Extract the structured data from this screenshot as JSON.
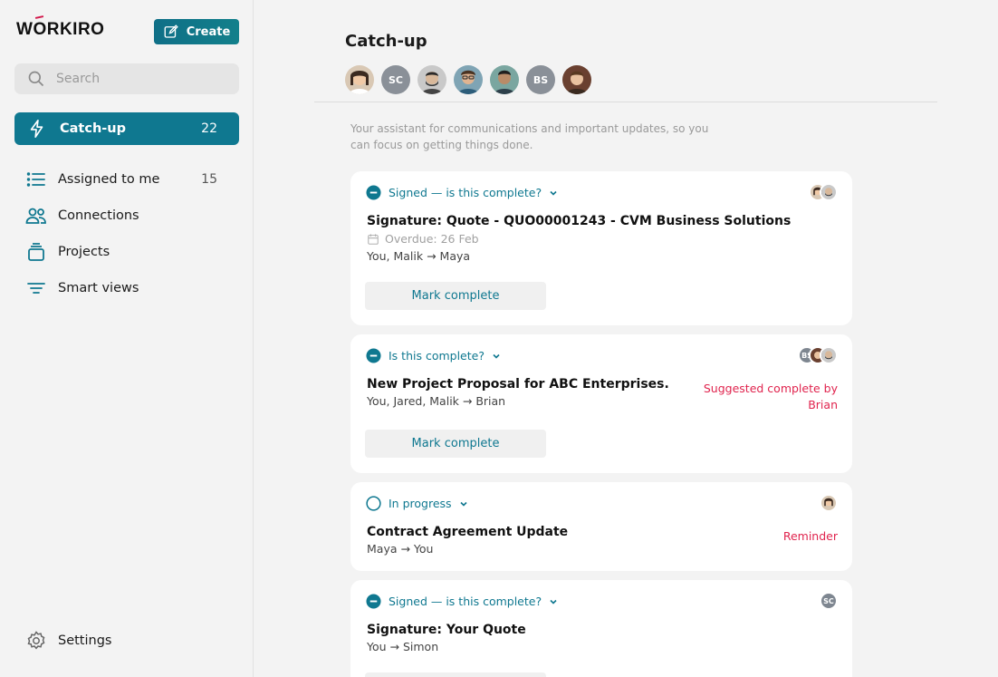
{
  "app": {
    "logo": "WORKIRO"
  },
  "sidebar": {
    "create_label": "Create",
    "search_placeholder": "Search",
    "active": {
      "label": "Catch-up",
      "count": "22"
    },
    "items": [
      {
        "label": "Assigned to me",
        "count": "15",
        "icon": "list-icon"
      },
      {
        "label": "Connections",
        "count": "",
        "icon": "people-icon"
      },
      {
        "label": "Projects",
        "count": "",
        "icon": "stack-icon"
      },
      {
        "label": "Smart views",
        "count": "",
        "icon": "filter-icon"
      }
    ],
    "settings_label": "Settings"
  },
  "main": {
    "title": "Catch-up",
    "participants": [
      "photo",
      "SC",
      "photo",
      "photo",
      "photo",
      "BS",
      "photo"
    ],
    "subtitle": "Your assistant for communications and important updates, so you can focus on getting things done.",
    "cards": [
      {
        "status": "Signed — is this complete?",
        "title": "Signature: Quote - QUO00001243 - CVM Business Solutions",
        "due": "Overdue: 26 Feb",
        "people": "You, Malik → Maya",
        "button": "Mark complete",
        "note": ""
      },
      {
        "status": "Is this complete?",
        "title": "New Project Proposal for ABC Enterprises.",
        "due": "",
        "people": "You, Jared, Malik → Brian",
        "button": "Mark complete",
        "note_line1": "Suggested complete by",
        "note_line2": "Brian",
        "mini_initials": "BS"
      },
      {
        "status": "In progress",
        "title": "Contract Agreement Update",
        "people": "Maya → You",
        "note": "Reminder"
      },
      {
        "status": "Signed — is this complete?",
        "title": "Signature: Your Quote",
        "people": "You → Simon",
        "mini_initials": "SC"
      }
    ]
  },
  "colors": {
    "accent": "#0f7890",
    "alert": "#e0244e",
    "logo_accent": "#d2174a"
  }
}
